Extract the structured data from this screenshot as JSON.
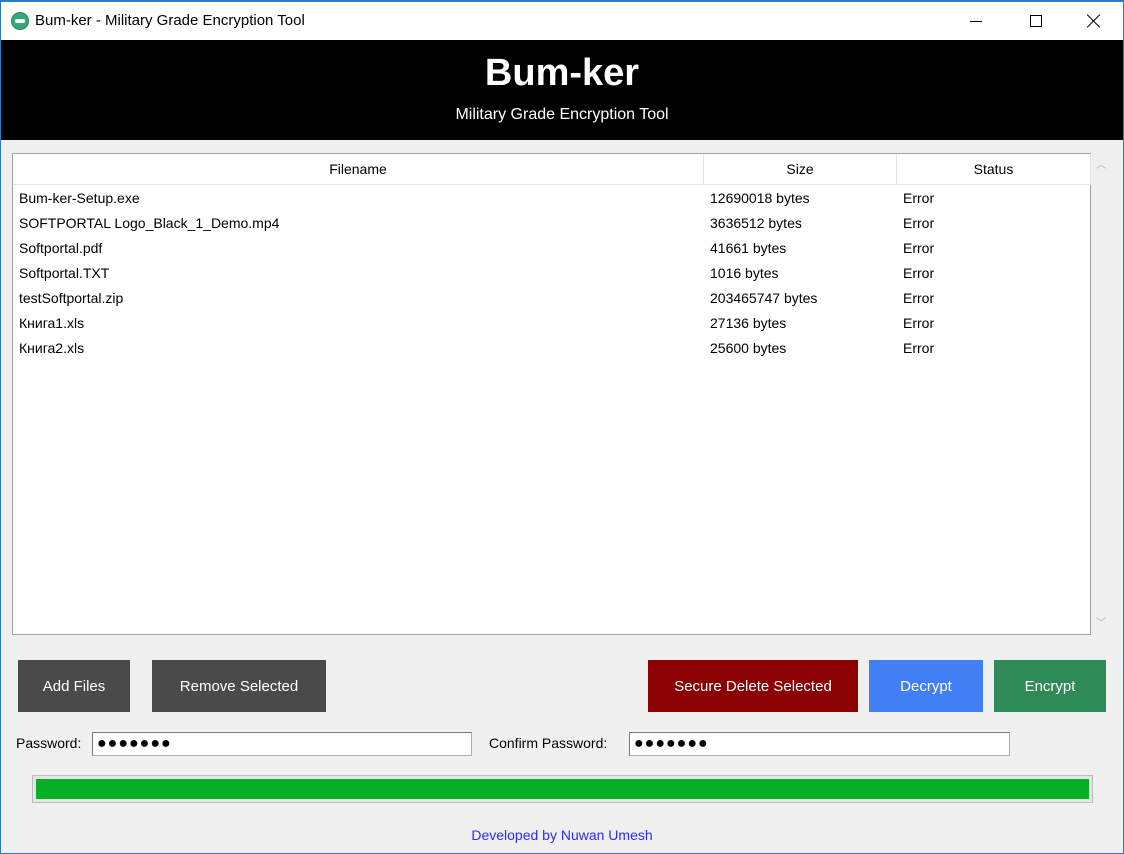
{
  "window": {
    "title": "Bum-ker - Military Grade Encryption Tool",
    "controls": [
      "minimize-icon",
      "maximize-icon",
      "close-icon"
    ]
  },
  "banner": {
    "title": "Bum-ker",
    "subtitle": "Military Grade Encryption Tool"
  },
  "table": {
    "columns": [
      "Filename",
      "Size",
      "Status"
    ],
    "rows": [
      {
        "name": "Bum-ker-Setup.exe",
        "size": "12690018 bytes",
        "status": "Error"
      },
      {
        "name": "SOFTPORTAL Logo_Black_1_Demo.mp4",
        "size": "3636512 bytes",
        "status": "Error"
      },
      {
        "name": "Softportal.pdf",
        "size": "41661 bytes",
        "status": "Error"
      },
      {
        "name": "Softportal.TXT",
        "size": "1016 bytes",
        "status": "Error"
      },
      {
        "name": "testSoftportal.zip",
        "size": "203465747 bytes",
        "status": "Error"
      },
      {
        "name": "Книга1.xls",
        "size": "27136 bytes",
        "status": "Error"
      },
      {
        "name": "Книга2.xls",
        "size": "25600 bytes",
        "status": "Error"
      }
    ]
  },
  "buttons": {
    "add": "Add Files",
    "remove": "Remove Selected",
    "secure_delete": "Secure Delete Selected",
    "decrypt": "Decrypt",
    "encrypt": "Encrypt"
  },
  "password": {
    "label": "Password:",
    "value": "●●●●●●●",
    "confirm_label": "Confirm Password:",
    "confirm_value": "●●●●●●●"
  },
  "progress": {
    "value_percent": 100,
    "color": "#06b025"
  },
  "footer": {
    "credit": "Developed by Nuwan Umesh"
  },
  "colors": {
    "secure_delete": "#8b0000",
    "decrypt": "#4080f4",
    "encrypt": "#2e8b57",
    "neutral_button": "#4a4a4a",
    "banner": "#000000"
  }
}
